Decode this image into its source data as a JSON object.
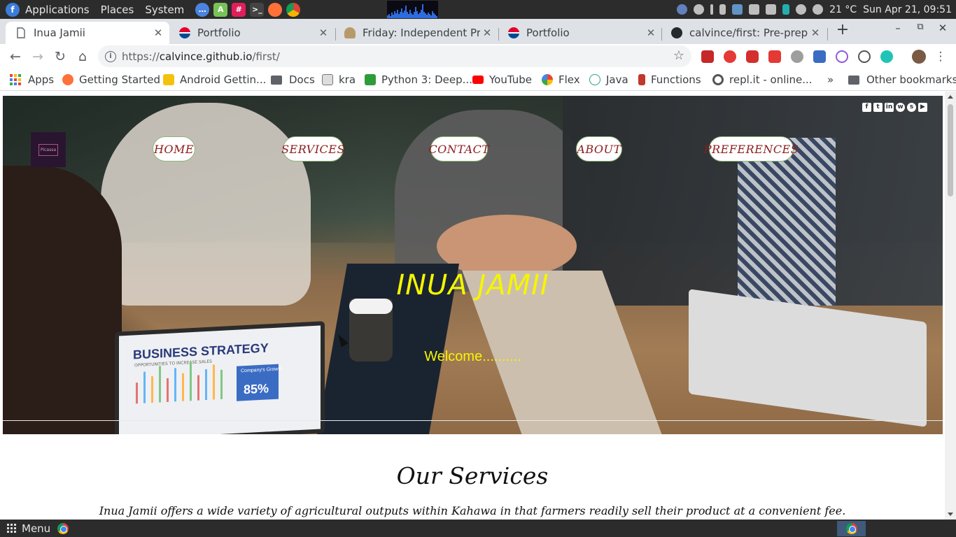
{
  "os_panel": {
    "menus": [
      "Applications",
      "Places",
      "System"
    ],
    "temperature": "21 °C",
    "clock": "Sun Apr 21, 09:51"
  },
  "tabs": [
    {
      "title": "Inua Jamii",
      "active": true
    },
    {
      "title": "Portfolio",
      "active": false
    },
    {
      "title": "Friday: Independent Proj",
      "active": false
    },
    {
      "title": "Portfolio",
      "active": false
    },
    {
      "title": "calvince/first: Pre-prep w",
      "active": false
    }
  ],
  "tab_close": "✕",
  "new_tab": "+",
  "window_controls": {
    "minimize": "–",
    "restore": "⧉",
    "close": "✕"
  },
  "address": {
    "scheme": "https://",
    "host": "calvince.github.io",
    "path": "/first/"
  },
  "bookmarks": {
    "apps": "Apps",
    "items": [
      "Getting Started",
      "Android Gettin...",
      "Docs",
      "kra",
      "Python 3: Deep...",
      "YouTube",
      "Flex",
      "Java",
      "Functions",
      "repl.it - online..."
    ],
    "overflow": "»",
    "other": "Other bookmarks"
  },
  "page": {
    "logo_text": "Picassa",
    "nav": [
      "HOME",
      "SERVICES",
      "CONTACT",
      "ABOUT",
      "PREFERENCES"
    ],
    "social_icons": [
      "facebook-icon",
      "twitter-icon",
      "linkedin-icon",
      "whatsapp-icon",
      "skype-icon",
      "youtube-icon"
    ],
    "hero_title": "INUA JAMII",
    "hero_subtitle": "Welcome..........",
    "laptop_screen": {
      "title": "BUSINESS STRATEGY",
      "small": "OPPORTUNITIES TO INCREASE SALES",
      "badge_label": "Company's Growth",
      "badge_value": "85%"
    },
    "section_title": "Our Services",
    "section_text": "Inua Jamii offers a wide variety of agricultural outputs within Kahawa in that farmers readily sell their product at a convenient fee."
  },
  "taskbar": {
    "menu_label": "Menu"
  },
  "colors": {
    "hero_text": "#f5f500",
    "nav_text": "#8b1c1c",
    "nav_border": "#8fb47a"
  }
}
